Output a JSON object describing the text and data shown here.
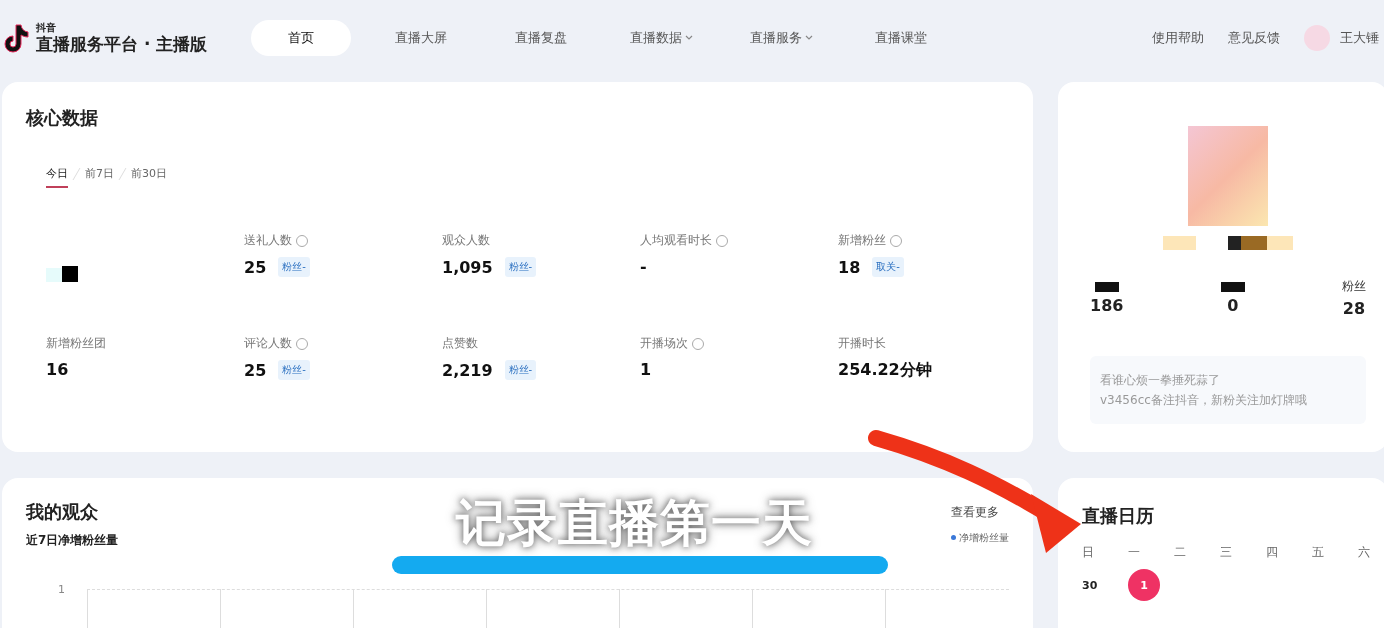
{
  "header": {
    "logo_small": "抖音",
    "title": "直播服务平台 · 主播版",
    "nav": [
      {
        "label": "首页",
        "selected": true,
        "dropdown": false
      },
      {
        "label": "直播大屏",
        "selected": false,
        "dropdown": false
      },
      {
        "label": "直播复盘",
        "selected": false,
        "dropdown": false
      },
      {
        "label": "直播数据",
        "selected": false,
        "dropdown": true
      },
      {
        "label": "直播服务",
        "selected": false,
        "dropdown": true
      },
      {
        "label": "直播课堂",
        "selected": false,
        "dropdown": false
      }
    ],
    "links": [
      "使用帮助",
      "意见反馈"
    ],
    "user_name": "王大锤"
  },
  "core_data": {
    "title": "核心数据",
    "periods": [
      {
        "label": "今日",
        "selected": true
      },
      {
        "label": "前7日",
        "selected": false
      },
      {
        "label": "前30日",
        "selected": false
      }
    ],
    "metrics": [
      {
        "kind": "pixelated"
      },
      {
        "kind": "metric",
        "label": "送礼人数",
        "help": true,
        "value": "25",
        "tag": "粉丝-"
      },
      {
        "kind": "metric",
        "label": "观众人数",
        "help": false,
        "value": "1,095",
        "tag": "粉丝-"
      },
      {
        "kind": "metric",
        "label": "人均观看时长",
        "help": true,
        "value": "-"
      },
      {
        "kind": "metric",
        "label": "新增粉丝",
        "help": true,
        "value": "18",
        "tag": "取关-"
      },
      {
        "kind": "metric",
        "label": "新增粉丝团",
        "help": false,
        "value": "16"
      },
      {
        "kind": "metric",
        "label": "评论人数",
        "help": true,
        "value": "25",
        "tag": "粉丝-"
      },
      {
        "kind": "metric",
        "label": "点赞数",
        "help": false,
        "value": "2,219",
        "tag": "粉丝-"
      },
      {
        "kind": "metric",
        "label": "开播场次",
        "help": true,
        "value": "1"
      },
      {
        "kind": "metric",
        "label": "开播时长",
        "help": false,
        "value": "254.22分钟"
      }
    ]
  },
  "profile": {
    "stats": [
      {
        "value": "186"
      },
      {
        "value": "0"
      },
      {
        "label": "粉丝",
        "value": "28"
      }
    ],
    "bio": [
      "看谁心烦一拳捶死蒜了",
      "v3456cc备注抖音，新粉关注加灯牌哦"
    ]
  },
  "audience": {
    "title": "我的观众",
    "more": "查看更多",
    "subtitle": "近7日净增粉丝量",
    "legend": "净增粉丝量",
    "y_tick": "1"
  },
  "calendar": {
    "title": "直播日历",
    "weekdays": [
      "日",
      "一",
      "二",
      "三",
      "四",
      "五",
      "六"
    ],
    "days": [
      {
        "label": "30",
        "selected": false
      },
      {
        "label": "1",
        "selected": true
      }
    ]
  },
  "annotation": {
    "caption": "记录直播第一天"
  }
}
